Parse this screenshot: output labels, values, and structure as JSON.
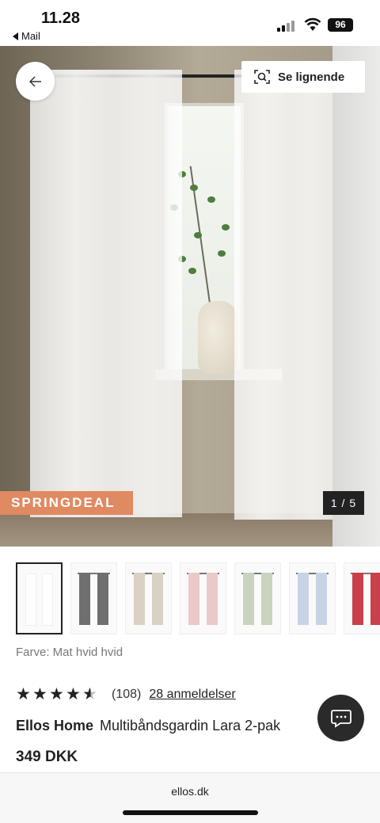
{
  "status_bar": {
    "time": "11.28",
    "back_app": "Mail",
    "battery": "96"
  },
  "hero": {
    "similar_button": "Se lignende",
    "badge": "SPRINGDEAL",
    "image_counter": "1 / 5",
    "back_icon": "arrow-left-icon",
    "similar_icon": "visual-search-icon"
  },
  "swatches": [
    {
      "name": "Mat hvid hvid",
      "color": "#ffffff",
      "selected": true
    },
    {
      "name": "gray",
      "color": "#6f6f6f"
    },
    {
      "name": "beige",
      "color": "#d9d1c4"
    },
    {
      "name": "rose",
      "color": "#e9c9c9"
    },
    {
      "name": "sage",
      "color": "#c9d3bd"
    },
    {
      "name": "light blue",
      "color": "#c9d3e6"
    },
    {
      "name": "red",
      "color": "#c9404b"
    }
  ],
  "color_label": "Farve: Mat hvid hvid",
  "rating": {
    "stars": 4.5,
    "count": "(108)",
    "reviews_link": "28 anmeldelser"
  },
  "product": {
    "brand": "Ellos Home",
    "name": "Multibåndsgardin Lara 2-pak",
    "price": "349 DKK"
  },
  "browser": {
    "url": "ellos.dk"
  },
  "colors": {
    "badge": "#e08a62",
    "dark": "#222222"
  }
}
